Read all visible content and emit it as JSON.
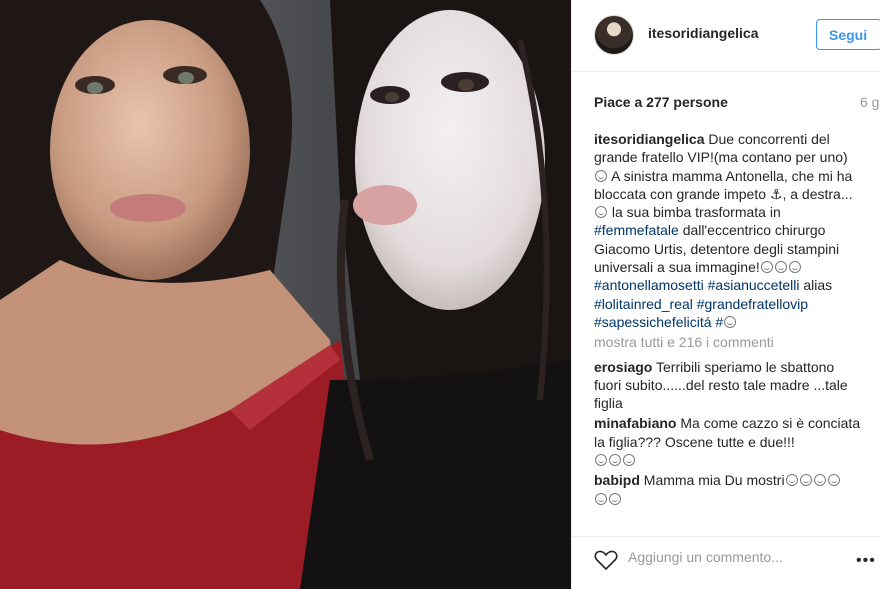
{
  "post": {
    "username": "itesoridiangelica",
    "follow_label": "Segui",
    "likes": "Piace a 277 persone",
    "time": "6 g",
    "caption": {
      "user": "itesoridiangelica",
      "text_1": "Due concorrenti del grande fratello VIP!(ma contano per uno)",
      "text_2": "A sinistra mamma Antonella, che mi ha bloccata con grande impeto",
      "text_3": ", a destra...",
      "text_4": "la sua bimba trasformata in",
      "tag_femmefatale": "#femmefatale",
      "text_5": "dall'eccentrico chirurgo Giacomo Urtis, detentore degli stampini universali a sua immagine!",
      "tags": [
        "#antonellamosetti",
        "#asianuccetelli",
        "alias",
        "#lolitainred_real",
        "#grandefratellovip",
        "#sapessichefelicitá",
        "#"
      ]
    },
    "more_comments": "mostra tutti e 216 i commenti",
    "comments": [
      {
        "user": "erosiago",
        "text": "Terribili speriamo le sbattono fuori subito......del resto tale madre ...tale figlia"
      },
      {
        "user": "minafabiano",
        "text": "Ma come cazzo si è conciata la figlia??? Oscene tutte e due!!!"
      },
      {
        "user": "babipd",
        "text": "Mamma mia Du mostri"
      }
    ],
    "add_comment_placeholder": "Aggiungi un commento...",
    "more_icon": "•••"
  },
  "icons": {
    "heart": "heart-icon",
    "more": "more-options-icon",
    "avatar": "avatar"
  },
  "colors": {
    "accent": "#3897f0",
    "hashtag": "#003569",
    "muted": "#999999",
    "photo_red": "#9b1c24"
  }
}
